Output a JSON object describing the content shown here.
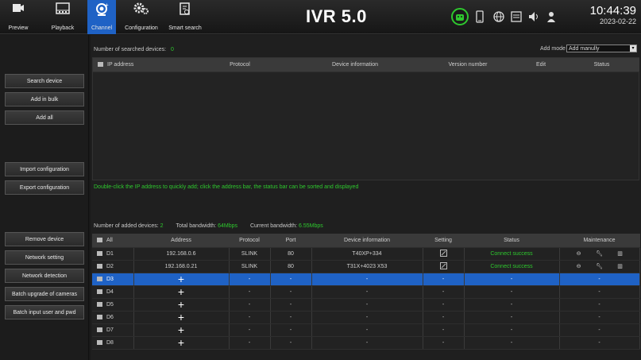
{
  "nav": {
    "preview": "Preview",
    "playback": "Playback",
    "channel": "Channel",
    "configuration": "Configuration",
    "smart_search": "Smart search"
  },
  "brand": "IVR 5.0",
  "clock": {
    "time": "10:44:39",
    "date": "2023-02-22"
  },
  "sidebar": {
    "search_device": "Search device",
    "add_in_bulk": "Add in bulk",
    "add_all": "Add all",
    "import_config": "Import configuration",
    "export_config": "Export configuration",
    "remove_device": "Remove device",
    "network_setting": "Network setting",
    "network_detection": "Network detection",
    "batch_upgrade": "Batch upgrade of cameras",
    "batch_input": "Batch input user and pwd"
  },
  "search": {
    "count_label": "Number of searched devices:",
    "count_value": "0",
    "add_mode_label": "Add mode",
    "add_mode_value": "Add manully",
    "columns": [
      "IP address",
      "Protocol",
      "Device information",
      "Version number",
      "Edit",
      "Status"
    ],
    "hint": "Double-click the IP address to quickly add; click the address bar, the status bar can be sorted and displayed"
  },
  "added": {
    "count_label": "Number of added devices:",
    "count_value": "2",
    "total_bw_label": "Total bandwidth:",
    "total_bw_value": "64Mbps",
    "cur_bw_label": "Current bandwidth:",
    "cur_bw_value": "6.55Mbps",
    "columns": [
      "All",
      "Address",
      "Protocol",
      "Port",
      "Device information",
      "Setting",
      "Status",
      "Maintenance"
    ],
    "rows": [
      {
        "id": "D1",
        "address": "192.168.0.6",
        "protocol": "SLINK",
        "port": "80",
        "info": "T40XP+334",
        "status": "Connect success"
      },
      {
        "id": "D2",
        "address": "192.168.0.21",
        "protocol": "SLINK",
        "port": "80",
        "info": "T31X+4023 X53",
        "status": "Connect success"
      },
      {
        "id": "D3",
        "address": "+",
        "protocol": "-",
        "port": "-",
        "info": "-",
        "setting": "-",
        "status": "-",
        "maint": "-"
      },
      {
        "id": "D4",
        "address": "+",
        "protocol": "-",
        "port": "-",
        "info": "-",
        "setting": "-",
        "status": "-",
        "maint": "-"
      },
      {
        "id": "D5",
        "address": "+",
        "protocol": "-",
        "port": "-",
        "info": "-",
        "setting": "-",
        "status": "-",
        "maint": "-"
      },
      {
        "id": "D6",
        "address": "+",
        "protocol": "-",
        "port": "-",
        "info": "-",
        "setting": "-",
        "status": "-",
        "maint": "-"
      },
      {
        "id": "D7",
        "address": "+",
        "protocol": "-",
        "port": "-",
        "info": "-",
        "setting": "-",
        "status": "-",
        "maint": "-"
      },
      {
        "id": "D8",
        "address": "+",
        "protocol": "-",
        "port": "-",
        "info": "-",
        "setting": "-",
        "status": "-",
        "maint": "-"
      }
    ]
  },
  "colors": {
    "accent": "#1f62c5",
    "success": "#2ec82e"
  }
}
